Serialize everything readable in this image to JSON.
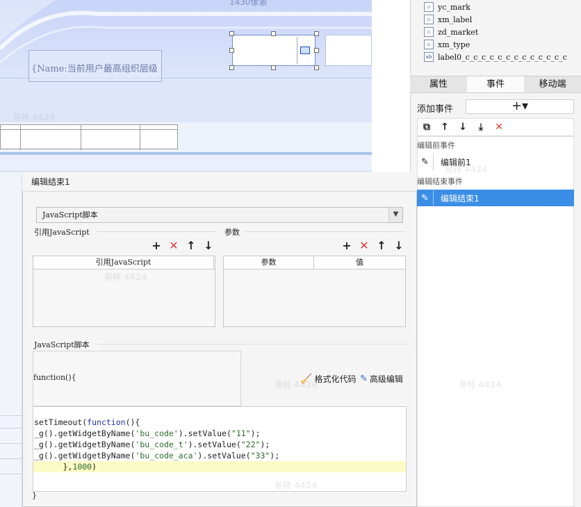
{
  "canvas": {
    "pixel_label": "1430像素",
    "name_placeholder": "{Name:当前用户最高组织层级"
  },
  "tree": {
    "items": [
      {
        "label": "yc_mark",
        "icon": "widget-icon"
      },
      {
        "label": "xm_label",
        "icon": "widget-icon"
      },
      {
        "label": "zd_market",
        "icon": "widget-icon"
      },
      {
        "label": "xm_type",
        "icon": "widget-icon"
      },
      {
        "label": "label0_c_c_c_c_c_c_c_c_c_c_c_c_c",
        "icon": "label-icon"
      }
    ]
  },
  "right_tabs": {
    "items": [
      {
        "label": "属性",
        "active": false
      },
      {
        "label": "事件",
        "active": true
      },
      {
        "label": "移动端",
        "active": false
      }
    ]
  },
  "events": {
    "add_label": "添加事件",
    "add_symbol": "+▾",
    "pre_section": "编辑前事件",
    "pre_item": "编辑前1",
    "end_section": "编辑结束事件",
    "end_item": "编辑结束1"
  },
  "dialog": {
    "title": "编辑结束1",
    "type_select": "JavaScript脚本",
    "ref_group": "引用JavaScript",
    "param_group": "参数",
    "ref_table_header": "引用JavaScript",
    "param_header": "参数",
    "value_header": "值",
    "script_group": "JavaScript脚本",
    "fn_open": "function(){",
    "format_btn": "格式化代码",
    "advanced_btn": "高级编辑",
    "fn_close": "}",
    "code_lines": [
      "setTimeout(function(){",
      "_g().getWidgetByName('bu_code').setValue(\"11\");",
      "_g().getWidgetByName('bu_code_t').setValue(\"22\");",
      "_g().getWidgetByName('bu_code_aca').setValue(\"33\");",
      "      },1000)"
    ]
  },
  "watermark": "易特 4424",
  "colors": {
    "selection_blue": "#3b8ee6",
    "delete_red": "#e03a3a",
    "highlight_line": "#fbfbc6"
  }
}
